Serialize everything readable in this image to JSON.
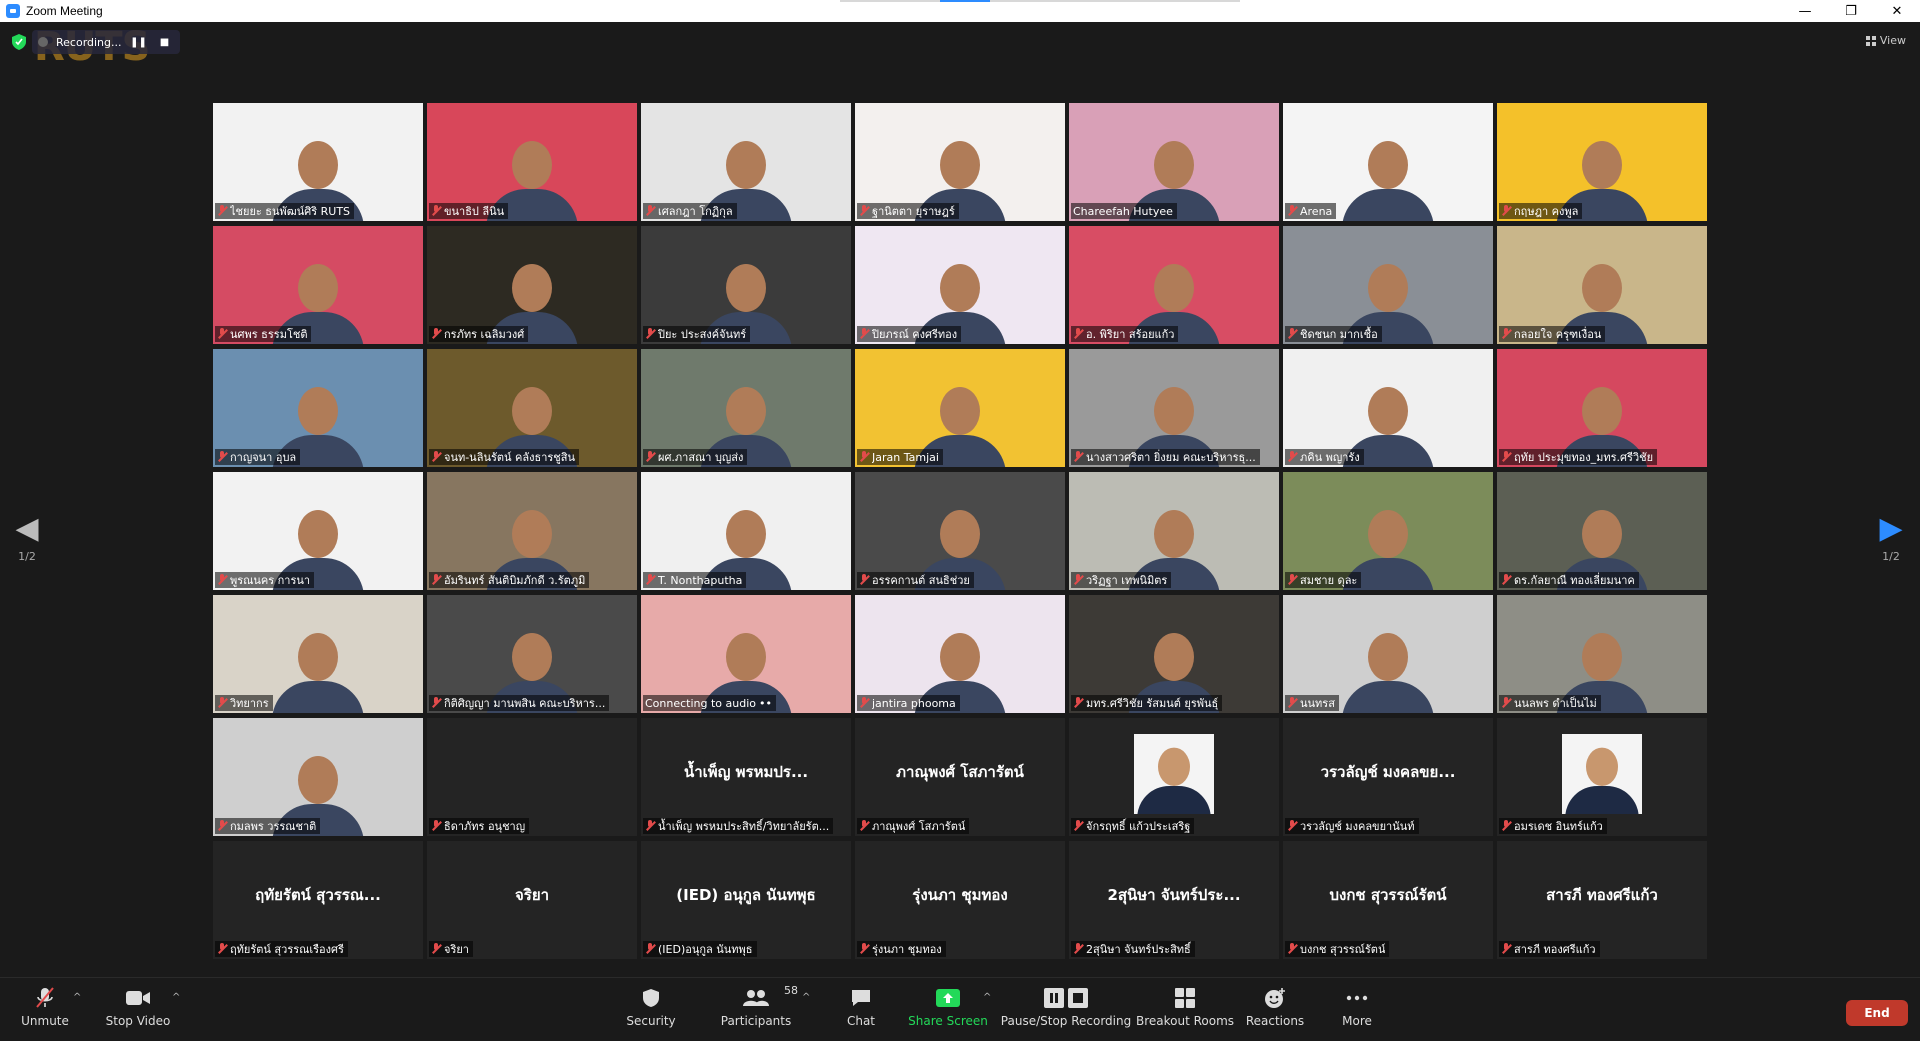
{
  "window": {
    "title": "Zoom Meeting",
    "minimize": "—",
    "maximize": "❐",
    "close": "✕"
  },
  "recording": {
    "label": "Recording...",
    "pause": "❚❚",
    "stop": "■"
  },
  "logo": {
    "left": "RUT",
    "right": "S"
  },
  "view": {
    "label": "View"
  },
  "pager": {
    "left": "1/2",
    "right": "1/2",
    "left_arrow": "◀",
    "right_arrow": "▶"
  },
  "tiles": [
    {
      "name": "ไชยยะ ธนพัฒน์ศิริ RUTS",
      "bg": "#f2f2f2",
      "muted": true
    },
    {
      "name": "ขนาธิป ลีนิน",
      "bg": "#d8475a",
      "muted": true
    },
    {
      "name": "เศลกฎา โกฏิกุล",
      "bg": "#e4e4e4",
      "muted": true
    },
    {
      "name": "ฐานิตตา ยุราษฎร์",
      "bg": "#f3f0ee",
      "muted": true
    },
    {
      "name": "Chareefah Hutyee",
      "bg": "#d9a0b7",
      "muted": false,
      "active": true
    },
    {
      "name": "Arena",
      "bg": "#f4f4f4",
      "muted": true
    },
    {
      "name": "กฤษฎา คงพูล",
      "bg": "#f4c12a",
      "muted": true
    },
    {
      "name": "นศพร ธรรมโชติ",
      "bg": "#d54b63",
      "muted": true
    },
    {
      "name": "กรภัทร เฉลิมวงศ์",
      "bg": "#2d2a22",
      "muted": true
    },
    {
      "name": "ปิยะ ประสงค์จันทร์",
      "bg": "#3b3b3b",
      "muted": true
    },
    {
      "name": "ปิยภรณ์ คงศรีทอง",
      "bg": "#efe7f2",
      "muted": true
    },
    {
      "name": "อ. พิริยา สร้อยแก้ว",
      "bg": "#d84d64",
      "muted": true
    },
    {
      "name": "ชิดชนก มากเชื้อ",
      "bg": "#8a8f96",
      "muted": true
    },
    {
      "name": "กลอยใจ ครุฑเงื่อน",
      "bg": "#c9b68a",
      "muted": true
    },
    {
      "name": "กาญจนา  อุบล",
      "bg": "#6b8fb0",
      "muted": true
    },
    {
      "name": "จนท-นลินรัตน์ คลังธารชูสิน",
      "bg": "#6d5a2c",
      "muted": true
    },
    {
      "name": "ผศ.ภาสณา บุญส่ง",
      "bg": "#6f7a6c",
      "muted": true
    },
    {
      "name": "Jaran Tamjai",
      "bg": "#f2c232",
      "muted": true
    },
    {
      "name": "นางสาวศริตา  ยิ่งยม คณะบริหารธุ...",
      "bg": "#9a9a9a",
      "muted": true
    },
    {
      "name": "ภคิน พญารัง",
      "bg": "#f0f0f0",
      "muted": true
    },
    {
      "name": "ฤทัย ประมุขทอง_มทร.ศรีวิชัย",
      "bg": "#d5485f",
      "muted": true
    },
    {
      "name": "พูรณนคร การนา",
      "bg": "#f2f2f2",
      "muted": true
    },
    {
      "name": "อัมรินทร์ สันติบิมภักดี ว.รัตภูมิ",
      "bg": "#877660",
      "muted": true
    },
    {
      "name": "T. Nonthaputha",
      "bg": "#f0f0f0",
      "muted": true
    },
    {
      "name": "อรรคกานต์ สนธิช่วย",
      "bg": "#4a4a4a",
      "muted": true
    },
    {
      "name": "วริฏฐา เทพนิมิตร",
      "bg": "#bcbcb4",
      "muted": true
    },
    {
      "name": "สมชาย ดุละ",
      "bg": "#7c8c5a",
      "muted": true
    },
    {
      "name": "ดร.กัลยาณี ทองเลี่ยมนาค",
      "bg": "#5c5f54",
      "muted": true
    },
    {
      "name": "วิทยากร",
      "bg": "#d9d3c8",
      "muted": true
    },
    {
      "name": "กิติศิญญา  มานพสิน คณะบริหาร...",
      "bg": "#4a4a4a",
      "muted": true
    },
    {
      "name": "Connecting to audio",
      "bg": "#e7aaa9",
      "muted": false,
      "connecting": true
    },
    {
      "name": "jantira phooma",
      "bg": "#ede4ee",
      "muted": true
    },
    {
      "name": "มทร.ศรีวิชัย รัสมนต์ ยุรพันธุ์",
      "bg": "#3d3a36",
      "muted": true
    },
    {
      "name": "นนทรส",
      "bg": "#cfcfcf",
      "muted": true
    },
    {
      "name": "นนลพร ดำเป็นไม่",
      "bg": "#8e8e86",
      "muted": true
    },
    {
      "name": "กมลพร วรรณชาติ",
      "bg": "#cfcfcf",
      "muted": true
    },
    {
      "name": "ธิดาภัทร อนุชาญ",
      "bg": "#242424",
      "muted": true
    },
    {
      "name": "น้ำเพ็ญ พรหมประสิทธิ์/วิทยาลัยรัต...",
      "bg": "#242424",
      "muted": true,
      "big": "น้ำเพ็ญ พรหมปร..."
    },
    {
      "name": "ภาณุพงศ์ โสภารัตน์",
      "bg": "#242424",
      "muted": true,
      "big": "ภาณุพงศ์ โสภารัตน์"
    },
    {
      "name": "จักรฤทธิ์ แก้วประเสริฐ",
      "bg": "#242424",
      "muted": true,
      "photo": true
    },
    {
      "name": "วรวลัญช์ มงคลขยานันท์",
      "bg": "#242424",
      "muted": true,
      "big": "วรวลัญช์ มงคลขย..."
    },
    {
      "name": "อมรเดช อินทร์แก้ว",
      "bg": "#242424",
      "muted": true,
      "photo": true
    },
    {
      "name": "ฤทัยรัตน์ สุวรรณเรืองศรี",
      "bg": "#242424",
      "muted": true,
      "big": "ฤทัยรัตน์ สุวรรณ..."
    },
    {
      "name": "จริยา",
      "bg": "#242424",
      "muted": true,
      "big": "จริยา"
    },
    {
      "name": "(IED)อนุกูล นันทพุธ",
      "bg": "#242424",
      "muted": true,
      "big": "(IED) อนุกูล นันทพุธ"
    },
    {
      "name": "รุ่งนภา ชุมทอง",
      "bg": "#242424",
      "muted": true,
      "big": "รุ่งนภา ชุมทอง"
    },
    {
      "name": "2สุนิษา จันทร์ประสิทธิ์",
      "bg": "#242424",
      "muted": true,
      "big": "2สุนิษา จันทร์ประ..."
    },
    {
      "name": "บงกช สุวรรณ์รัตน์",
      "bg": "#242424",
      "muted": true,
      "big": "บงกช สุวรรณ์รัตน์"
    },
    {
      "name": "สารภี ทองศรีแก้ว",
      "bg": "#242424",
      "muted": true,
      "big": "สารภี  ทองศรีแก้ว"
    }
  ],
  "toolbar": {
    "unmute": "Unmute",
    "stop_video": "Stop Video",
    "security": "Security",
    "participants": "Participants",
    "participants_count": "58",
    "chat": "Chat",
    "share_screen": "Share Screen",
    "recording": "Pause/Stop Recording",
    "breakout": "Breakout Rooms",
    "reactions": "Reactions",
    "more": "More",
    "end": "End",
    "caret": "^"
  },
  "colors": {
    "accent": "#2d8cff",
    "share": "#23d959",
    "end": "#c0392b",
    "active_speaker": "#a8d64a",
    "muted_mic": "#e24b4b"
  }
}
